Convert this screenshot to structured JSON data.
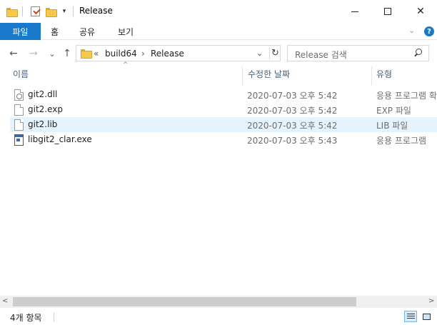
{
  "window": {
    "title": "Release",
    "minimize_label": "—",
    "maximize_label": "",
    "close_label": "✕"
  },
  "ribbon": {
    "file_tab": "파일",
    "tabs": [
      "홈",
      "공유",
      "보기"
    ],
    "expand_icon": "chevron-down-icon",
    "help_icon": "?"
  },
  "navigation": {
    "back_icon": "←",
    "forward_icon": "→",
    "recent_icon": "⌄",
    "up_icon": "↑",
    "breadcrumb_prefix": "«",
    "path": [
      "build64",
      "Release"
    ],
    "path_separator": "›",
    "refresh_icon": "↻",
    "dropdown_icon": "⌄"
  },
  "search": {
    "placeholder": "Release 검색"
  },
  "columns": {
    "name": "이름",
    "modified": "수정한 날짜",
    "type": "유형",
    "sort_indicator": "^"
  },
  "files": [
    {
      "name": "git2.dll",
      "modified": "2020-07-03 오후 5:42",
      "type": "응용 프로그램 확",
      "icon": "dll-file-icon",
      "selected": false
    },
    {
      "name": "git2.exp",
      "modified": "2020-07-03 오후 5:42",
      "type": "EXP 파일",
      "icon": "file-icon",
      "selected": false
    },
    {
      "name": "git2.lib",
      "modified": "2020-07-03 오후 5:42",
      "type": "LIB 파일",
      "icon": "file-icon",
      "selected": true
    },
    {
      "name": "libgit2_clar.exe",
      "modified": "2020-07-03 오후 5:43",
      "type": "응용 프로그램",
      "icon": "exe-file-icon",
      "selected": false
    }
  ],
  "scrollbar": {
    "left_arrow": "<",
    "right_arrow": ">"
  },
  "status": {
    "item_count": "4개 항목"
  },
  "colors": {
    "accent": "#1979ca",
    "selection": "#e5f3ff",
    "header_text": "#4c607a"
  }
}
